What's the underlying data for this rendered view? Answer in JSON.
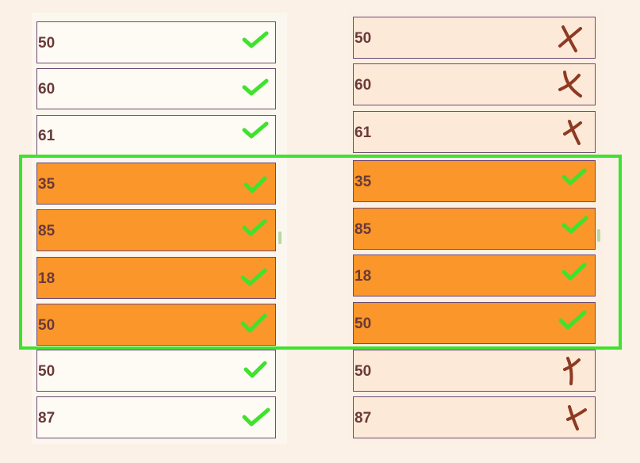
{
  "left_column": {
    "rows": [
      {
        "value": "50",
        "status": "check"
      },
      {
        "value": "60",
        "status": "check"
      },
      {
        "value": "61",
        "status": "check"
      },
      {
        "value": "35",
        "status": "check"
      },
      {
        "value": "85",
        "status": "check"
      },
      {
        "value": "18",
        "status": "check"
      },
      {
        "value": "50",
        "status": "check"
      },
      {
        "value": "50",
        "status": "check"
      },
      {
        "value": "87",
        "status": "check"
      }
    ]
  },
  "right_column": {
    "rows": [
      {
        "value": "50",
        "status": "cross"
      },
      {
        "value": "60",
        "status": "cross"
      },
      {
        "value": "61",
        "status": "cross"
      },
      {
        "value": "35",
        "status": "check"
      },
      {
        "value": "85",
        "status": "check"
      },
      {
        "value": "18",
        "status": "check"
      },
      {
        "value": "50",
        "status": "check"
      },
      {
        "value": "50",
        "status": "cross"
      },
      {
        "value": "87",
        "status": "cross"
      }
    ]
  },
  "highlighted_rows": [
    3,
    4,
    5,
    6
  ],
  "icons": {
    "check": "checkmark-icon",
    "cross": "cross-mark-icon"
  },
  "colors": {
    "highlight": "#fa962a",
    "check": "#3fe22c",
    "cross": "#8e3a22",
    "selection_border": "#3fe22c"
  }
}
